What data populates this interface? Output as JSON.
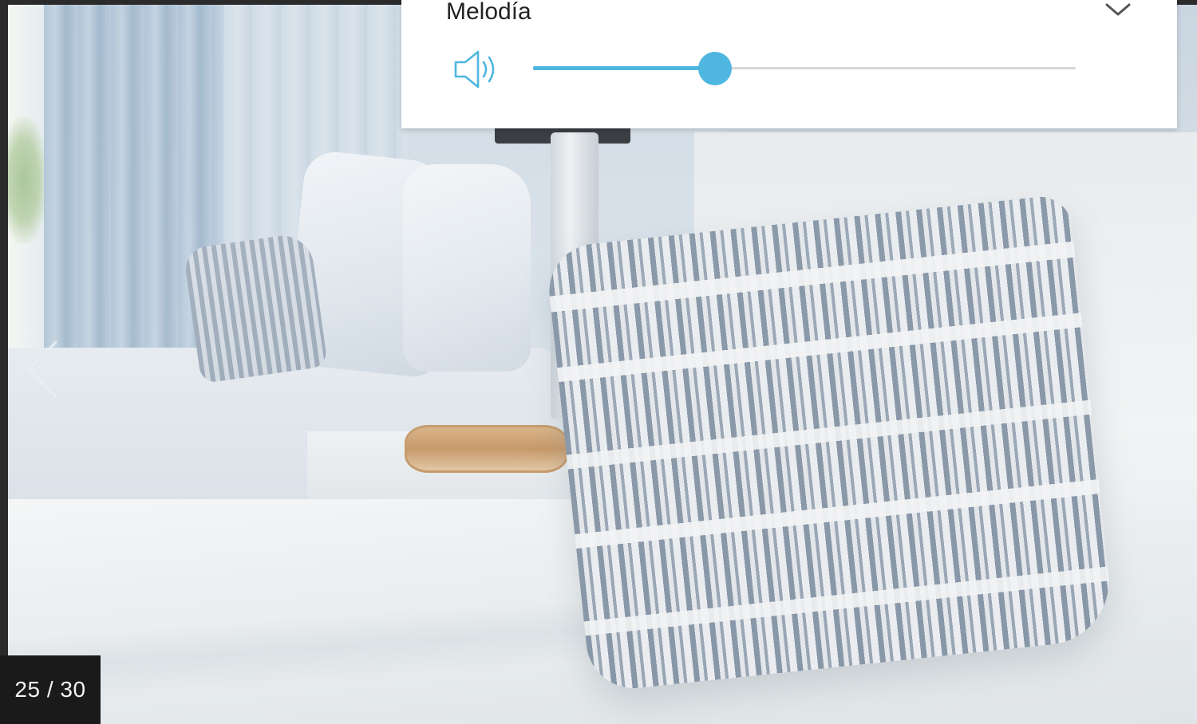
{
  "audio": {
    "title": "Melodía",
    "volume": 0.335,
    "accent_color": "#4fb6e0",
    "volume_icon": "speaker-volume-icon",
    "expand_icon": "chevron-down-icon"
  },
  "gallery": {
    "counter": "25 / 30",
    "prev_icon": "chevron-left-icon"
  }
}
